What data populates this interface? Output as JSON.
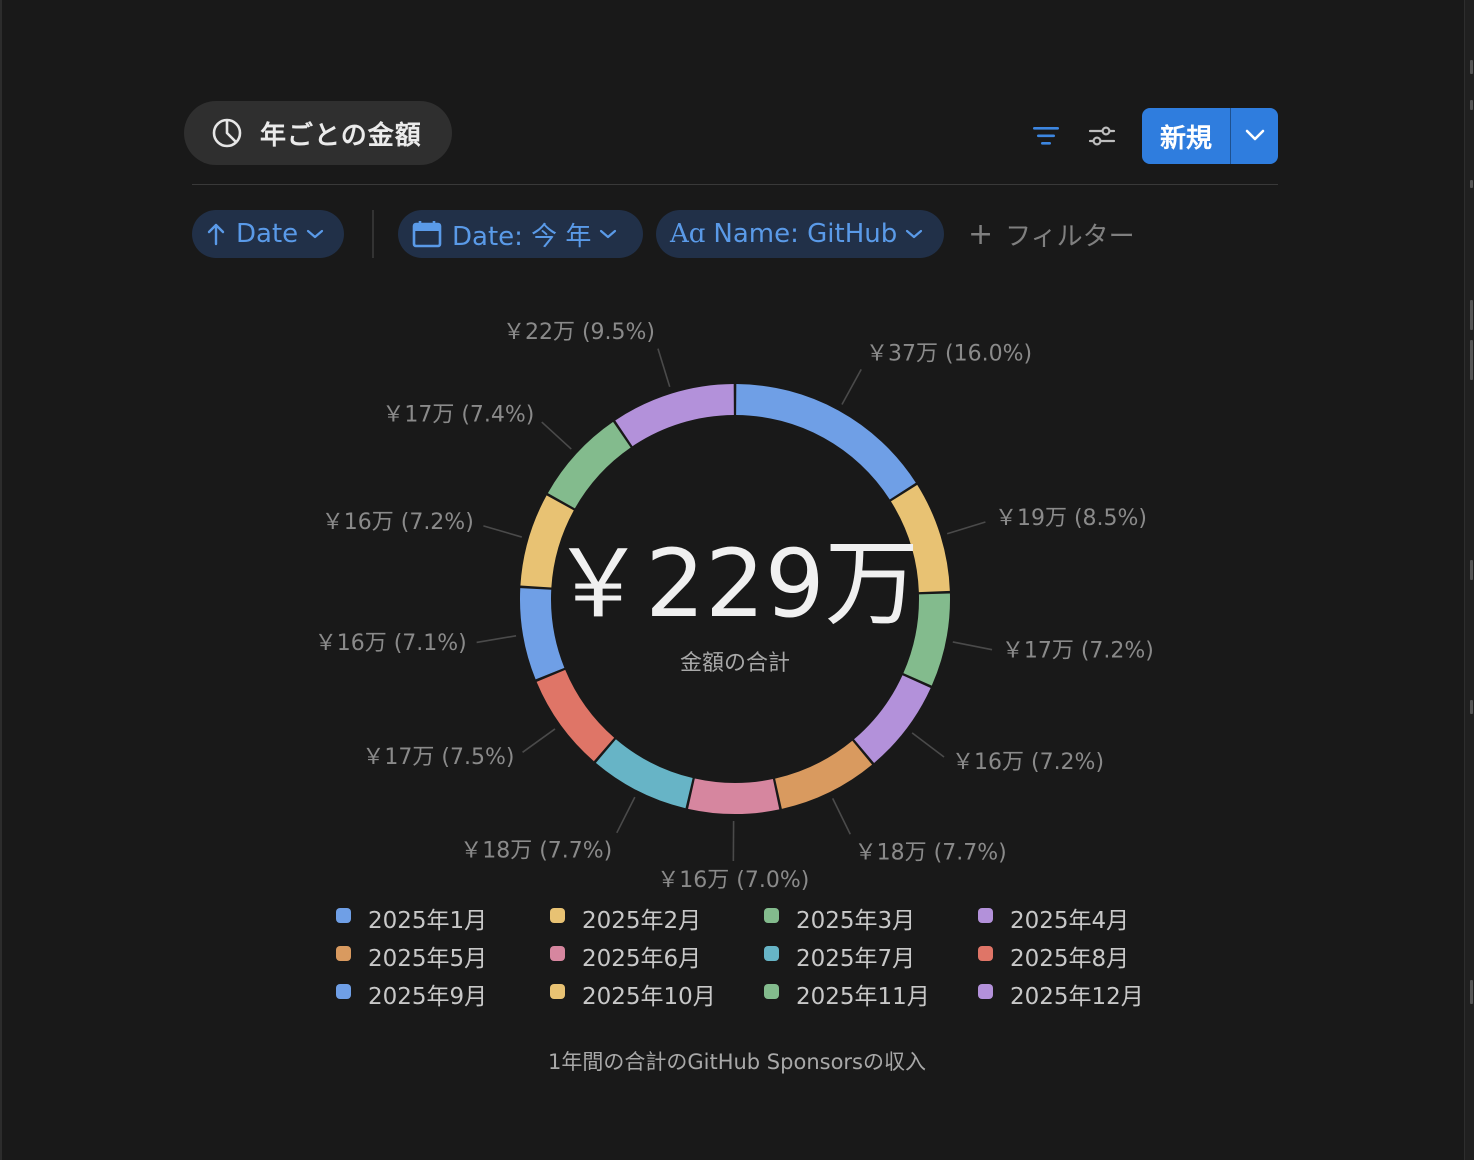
{
  "view_tab": {
    "label": "年ごとの金額",
    "icon": "pie-chart-icon"
  },
  "toolbar": {
    "new_label": "新規"
  },
  "filters": {
    "sort_label": "Date",
    "date_label": "Date: 今 年",
    "name_label": "Name: GitHub",
    "add_label": "フィルター"
  },
  "colors": {
    "accent": "#2f7dde",
    "chip_bg": "#213048",
    "chip_text": "#5a9ae8"
  },
  "chart_data": {
    "type": "pie",
    "donut": true,
    "center_value": "￥229万",
    "center_label": "金額の合計",
    "caption": "1年間の合計のGitHub Sponsorsの収入",
    "legend_position": "bottom",
    "slices": [
      {
        "name": "2025年1月",
        "label": "￥37万 (16.0%)",
        "percent": 16.0,
        "color": "#6f9fe6"
      },
      {
        "name": "2025年2月",
        "label": "￥19万 (8.5%)",
        "percent": 8.5,
        "color": "#e8c273"
      },
      {
        "name": "2025年3月",
        "label": "￥17万 (7.2%)",
        "percent": 7.2,
        "color": "#83bb8d"
      },
      {
        "name": "2025年4月",
        "label": "￥16万 (7.2%)",
        "percent": 7.2,
        "color": "#b391da"
      },
      {
        "name": "2025年5月",
        "label": "￥18万 (7.7%)",
        "percent": 7.7,
        "color": "#d99a5f"
      },
      {
        "name": "2025年6月",
        "label": "￥16万 (7.0%)",
        "percent": 7.0,
        "color": "#d6869f"
      },
      {
        "name": "2025年7月",
        "label": "￥18万 (7.7%)",
        "percent": 7.7,
        "color": "#67b4c6"
      },
      {
        "name": "2025年8月",
        "label": "￥17万 (7.5%)",
        "percent": 7.5,
        "color": "#df7567"
      },
      {
        "name": "2025年9月",
        "label": "￥16万 (7.1%)",
        "percent": 7.1,
        "color": "#6f9fe6"
      },
      {
        "name": "2025年10月",
        "label": "￥16万 (7.2%)",
        "percent": 7.2,
        "color": "#e8c273"
      },
      {
        "name": "2025年11月",
        "label": "￥17万 (7.4%)",
        "percent": 7.4,
        "color": "#83bb8d"
      },
      {
        "name": "2025年12月",
        "label": "￥22万 (9.5%)",
        "percent": 9.5,
        "color": "#b391da"
      }
    ]
  }
}
